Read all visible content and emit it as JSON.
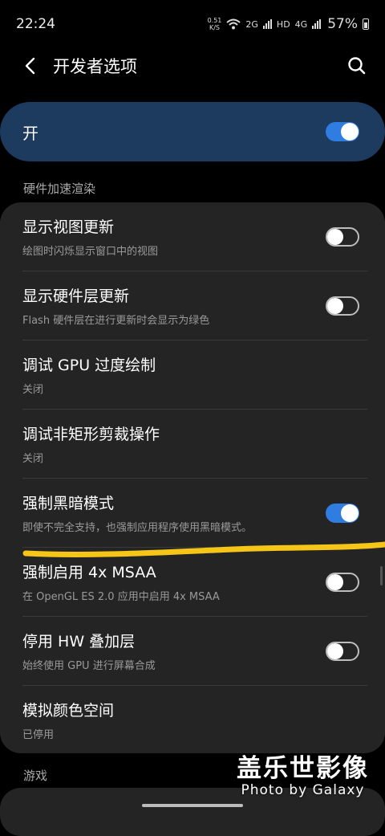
{
  "status_bar": {
    "time": "22:24",
    "net_speed_value": "0.51",
    "net_speed_unit": "K/S",
    "sim1_type": "2G",
    "hd": "HD",
    "sim2_type": "4G",
    "battery": "57%"
  },
  "header": {
    "title": "开发者选项",
    "back_icon": "chevron-left-icon",
    "search_icon": "search-icon"
  },
  "master": {
    "label": "开",
    "on": true,
    "accent": "#2f7de1",
    "background": "#1d3a5f"
  },
  "section": {
    "title": "硬件加速渲染",
    "next_title": "游戏"
  },
  "settings": [
    {
      "title": "显示视图更新",
      "subtitle": "绘图时闪烁显示窗口中的视图",
      "toggle": "off"
    },
    {
      "title": "显示硬件层更新",
      "subtitle": "Flash 硬件层在进行更新时会显示为绿色",
      "toggle": "off"
    },
    {
      "title": "调试 GPU 过度绘制",
      "subtitle": "关闭"
    },
    {
      "title": "调试非矩形剪裁操作",
      "subtitle": "关闭"
    },
    {
      "title": "强制黑暗模式",
      "subtitle": "即使不完全支持，也强制应用程序使用黑暗模式。",
      "toggle": "on"
    },
    {
      "title": "强制启用 4x MSAA",
      "subtitle": "在 OpenGL ES 2.0 应用中启用 4x MSAA",
      "toggle": "off"
    },
    {
      "title": "停用 HW 叠加层",
      "subtitle": "始终使用 GPU 进行屏幕合成",
      "toggle": "off"
    },
    {
      "title": "模拟颜色空间",
      "subtitle": "已停用"
    }
  ],
  "watermark": {
    "main": "盖乐世影像",
    "sub": "Photo by Galaxy"
  },
  "annotation_color": "#f5c518"
}
